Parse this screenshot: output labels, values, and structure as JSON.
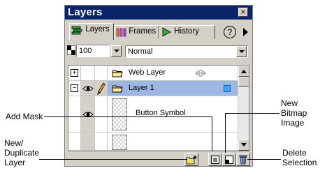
{
  "panel": {
    "title": "Layers",
    "close_glyph": "×",
    "tabs": [
      {
        "label": "Layers",
        "icon": "layers-tab-icon",
        "active": true
      },
      {
        "label": "Frames",
        "icon": "frames-tab-icon",
        "active": false
      },
      {
        "label": "History",
        "icon": "history-tab-icon",
        "active": false
      }
    ],
    "help_glyph": "?",
    "opacity": {
      "value": "100"
    },
    "blend_mode": {
      "value": "Normal"
    }
  },
  "layers": [
    {
      "label": "Web Layer",
      "expand": "+",
      "visible": false,
      "editable": false,
      "selected": false
    },
    {
      "label": "Layer 1",
      "expand": "−",
      "visible": true,
      "editable": true,
      "selected": true
    },
    {
      "label": "Button Symbol",
      "visible": true,
      "object": true
    }
  ],
  "colors": {
    "title_bar": "#0a246a",
    "selected_row": "#9db6e3",
    "panel_bg": "#d4d0c8",
    "layer_color_swatch": "#3ea6f2"
  },
  "callouts": {
    "add_mask": "Add Mask",
    "new_bitmap_line1": "New",
    "new_bitmap_line2": "Bitmap",
    "new_bitmap_line3": "Image",
    "new_dup_line1": "New/",
    "new_dup_line2": "Duplicate",
    "new_dup_line3": "Layer",
    "delete_line1": "Delete",
    "delete_line2": "Selection"
  }
}
